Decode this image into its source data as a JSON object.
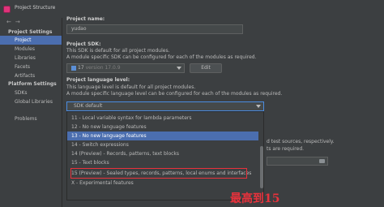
{
  "window": {
    "title": "Project Structure"
  },
  "sidebar": {
    "nav_back": "←",
    "nav_forward": "→",
    "project_settings_heading": "Project Settings",
    "project_settings_items": [
      "Project",
      "Modules",
      "Libraries",
      "Facets",
      "Artifacts"
    ],
    "selected_item": "Project",
    "platform_settings_heading": "Platform Settings",
    "platform_settings_items": [
      "SDKs",
      "Global Libraries"
    ],
    "problems": "Problems"
  },
  "project": {
    "name_label": "Project name:",
    "name_value": "yudao",
    "sdk_label": "Project SDK:",
    "sdk_desc1": "This SDK is default for all project modules.",
    "sdk_desc2": "A module specific SDK can be configured for each of the modules as required.",
    "sdk_name": "17",
    "sdk_version": "version 17.0.9",
    "edit_button": "Edit",
    "lang_label": "Project language level:",
    "lang_desc1": "This language level is default for all project modules.",
    "lang_desc2": "A module specific language level can be configured for each of the modules as required.",
    "lang_selected": "SDK default"
  },
  "language_options": [
    "11 - Local variable syntax for lambda parameters",
    "12 - No new language features",
    "13 - No new language features",
    "14 - Switch expressions",
    "14 (Preview) - Records, patterns, text blocks",
    "15 - Text blocks",
    "15 (Preview) - Sealed types, records, patterns, local enums and interfaces",
    "X - Experimental features"
  ],
  "highlighted_option": "13 - No new language features",
  "boxed_option": "15 (Preview) - Sealed types, records, patterns, local enums and interfaces",
  "behind": {
    "text1": "d test sources, respectively.",
    "text2": "ts are required."
  },
  "annotation": "最高到15",
  "colors": {
    "background": "#3c3f41",
    "selection": "#4b6eaf",
    "annotation_red": "#e8323c"
  }
}
